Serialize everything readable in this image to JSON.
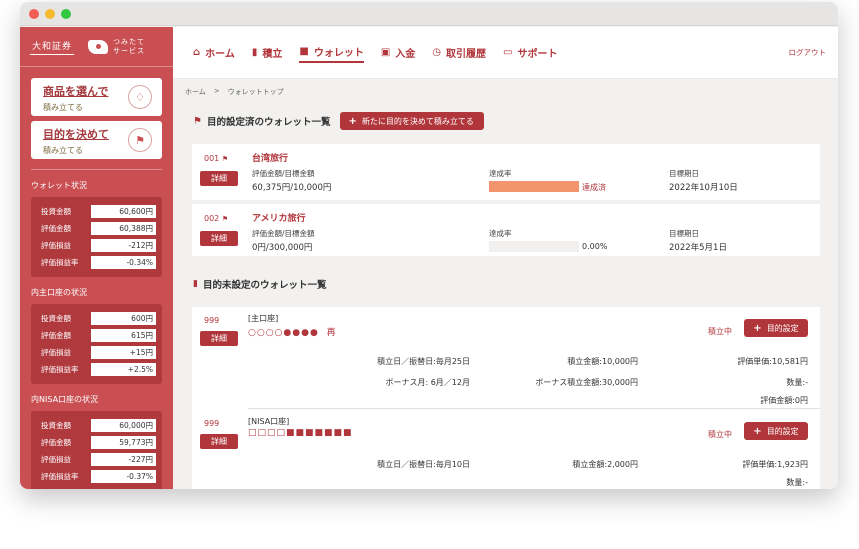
{
  "sidebar": {
    "brand_name": "大和証券",
    "brand_service": [
      "つみたて",
      "サービス"
    ],
    "promo_product": {
      "title": "商品を選んで",
      "sub": "積み立てる"
    },
    "promo_goal": {
      "title": "目的を決めて",
      "sub": "積み立てる"
    },
    "sections": [
      {
        "title": "ウォレット状況",
        "rows": [
          {
            "label": "投資金額",
            "value": "60,600円"
          },
          {
            "label": "評価金額",
            "value": "60,388円"
          },
          {
            "label": "評価損益",
            "value": "-212円"
          },
          {
            "label": "評価損益率",
            "value": "-0.34%"
          }
        ]
      },
      {
        "title": "内主口座の状況",
        "rows": [
          {
            "label": "投資金額",
            "value": "600円"
          },
          {
            "label": "評価金額",
            "value": "615円"
          },
          {
            "label": "評価損益",
            "value": "+15円"
          },
          {
            "label": "評価損益率",
            "value": "+2.5%"
          }
        ]
      },
      {
        "title": "内NISA口座の状況",
        "rows": [
          {
            "label": "投資金額",
            "value": "60,000円"
          },
          {
            "label": "評価金額",
            "value": "59,773円"
          },
          {
            "label": "評価損益",
            "value": "-227円"
          },
          {
            "label": "評価損益率",
            "value": "-0.37%"
          }
        ]
      }
    ]
  },
  "nav": {
    "items": [
      {
        "label": "ホーム",
        "icon": "home-icon"
      },
      {
        "label": "積立",
        "icon": "bar-chart-icon"
      },
      {
        "label": "ウォレット",
        "icon": "wallet-icon"
      },
      {
        "label": "入金",
        "icon": "deposit-icon"
      },
      {
        "label": "取引履歴",
        "icon": "clock-icon"
      },
      {
        "label": "サポート",
        "icon": "book-icon"
      }
    ],
    "logout": "ログアウト"
  },
  "breadcrumb": {
    "home": "ホーム",
    "sep": ">",
    "current": "ウォレットトップ"
  },
  "goal_section": {
    "title": "目的設定済のウォレット一覧",
    "new_button": "新たに目的を決めて積み立てる",
    "wallets": [
      {
        "num": "001",
        "name": "台湾旅行",
        "detail": "詳細",
        "amount_label": "評価金額/目標金額",
        "amount": "60,375円/10,000円",
        "rate_label": "達成率",
        "rate_fill": 1.0,
        "rate_text": "達成済",
        "date_label": "目標期日",
        "date": "2022年10月10日"
      },
      {
        "num": "002",
        "name": "アメリカ旅行",
        "detail": "詳細",
        "amount_label": "評価金額/目標金額",
        "amount": "0円/300,000円",
        "rate_label": "達成率",
        "rate_fill": 0.0,
        "rate_text": "0.00%",
        "date_label": "目標期日",
        "date": "2022年5月1日"
      }
    ]
  },
  "unset_section": {
    "title": "目的未設定のウォレット一覧",
    "wallets": [
      {
        "num": "999",
        "detail": "詳細",
        "account": "[主口座]",
        "marks": "○○○○●●●●",
        "marks_suffix": "再",
        "status": "積立中",
        "goal_button": "目的設定",
        "cells": [
          "積立日／振替日:毎月25日",
          "積立金額:10,000円",
          "評価単価:10,581円",
          "ボーナス月: 6月／12月",
          "ボーナス積立金額:30,000円",
          "数量:-",
          "評価金額:0円"
        ]
      },
      {
        "num": "999",
        "detail": "詳細",
        "account": "[NISA口座]",
        "marks": "□□□□■■■■■■■",
        "marks_suffix": "",
        "status": "積立中",
        "goal_button": "目的設定",
        "cells": [
          "積立日／振替日:毎月10日",
          "積立金額:2,000円",
          "評価単価:1,923円",
          "数量:-"
        ]
      }
    ]
  }
}
